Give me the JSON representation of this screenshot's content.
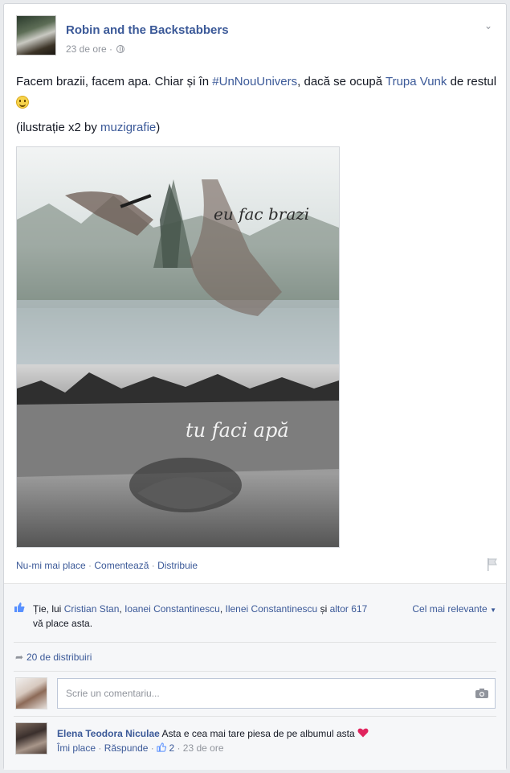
{
  "post": {
    "page_name": "Robin and the Backstabbers",
    "time": "23 de ore",
    "meta_sep": " · ",
    "text": {
      "part1": "Facem brazii, facem apa. Chiar și în ",
      "hashtag": "#UnNouUnivers",
      "part2": ", dacă se ocupă ",
      "mention": "Trupa Vunk",
      "part3": " de restul "
    },
    "credit": {
      "prefix": "(ilustrație x2 by ",
      "link": "muzigrafie",
      "suffix": ")"
    },
    "photo": {
      "top_caption": "eu fac brazi",
      "bottom_caption": "tu faci apă"
    },
    "actions": {
      "unlike": "Nu-mi mai place",
      "comment": "Comentează",
      "share": "Distribuie",
      "sep": " · "
    }
  },
  "likes": {
    "prefix": "Ție, lui ",
    "names": [
      "Cristian Stan",
      "Ioanei Constantinescu",
      "Ilenei Constantinescu"
    ],
    "sep1": ", ",
    "sep2": ", ",
    "and": " și ",
    "others": "altor 617",
    "suffix": " vă place asta.",
    "relevance": "Cel mai relevante"
  },
  "shares": {
    "label": "20 de distribuiri"
  },
  "comment_box": {
    "placeholder": "Scrie un comentariu..."
  },
  "comments": [
    {
      "author": "Elena Teodora Niculae",
      "text": "Asta e cea mai tare piesa de pe albumul asta",
      "like_label": "Îmi place",
      "reply_label": "Răspunde",
      "like_count": "2",
      "time": "23 de ore",
      "sep": " · "
    }
  ],
  "colors": {
    "link": "#3b5998",
    "muted": "#90949c",
    "heart": "#e0245e"
  }
}
